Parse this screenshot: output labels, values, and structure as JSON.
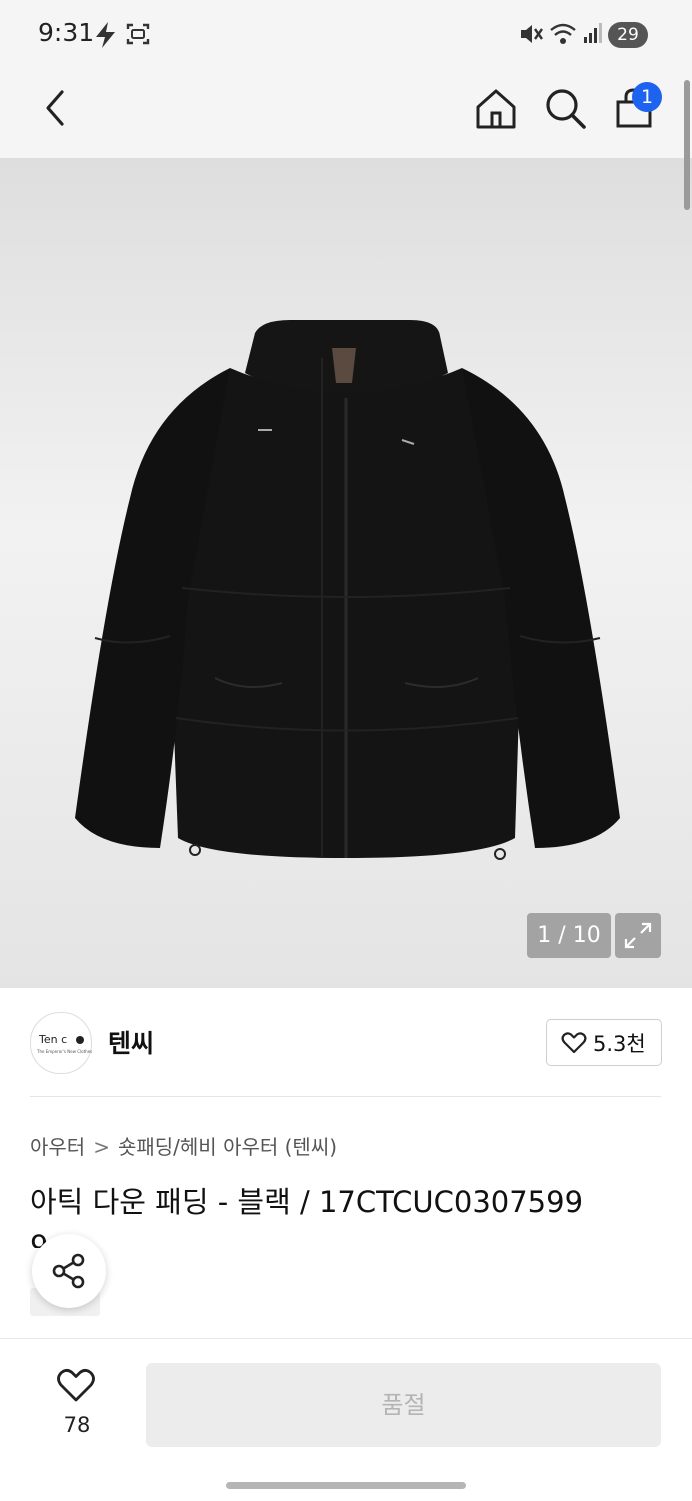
{
  "status_bar": {
    "time": "9:31",
    "battery": "29"
  },
  "header": {
    "cart_count": "1"
  },
  "gallery": {
    "counter": "1 / 10"
  },
  "brand": {
    "name": "텐씨",
    "logo_text": "Ten c",
    "logo_subtext": "The Emperor's New Clothes",
    "likes": "5.3천"
  },
  "product": {
    "breadcrumb": [
      "아우터",
      "숏패딩/헤비 아우터 (텐씨)"
    ],
    "title": "아틱 다운 패딩 - 블랙 / 17CTCUC0307599",
    "title_continued": "9"
  },
  "bottom": {
    "wish_count": "78",
    "buy_label": "품절"
  },
  "colors": {
    "accent": "#1e63f0",
    "disabled_bg": "#ececec",
    "disabled_text": "#b4b4b4"
  }
}
